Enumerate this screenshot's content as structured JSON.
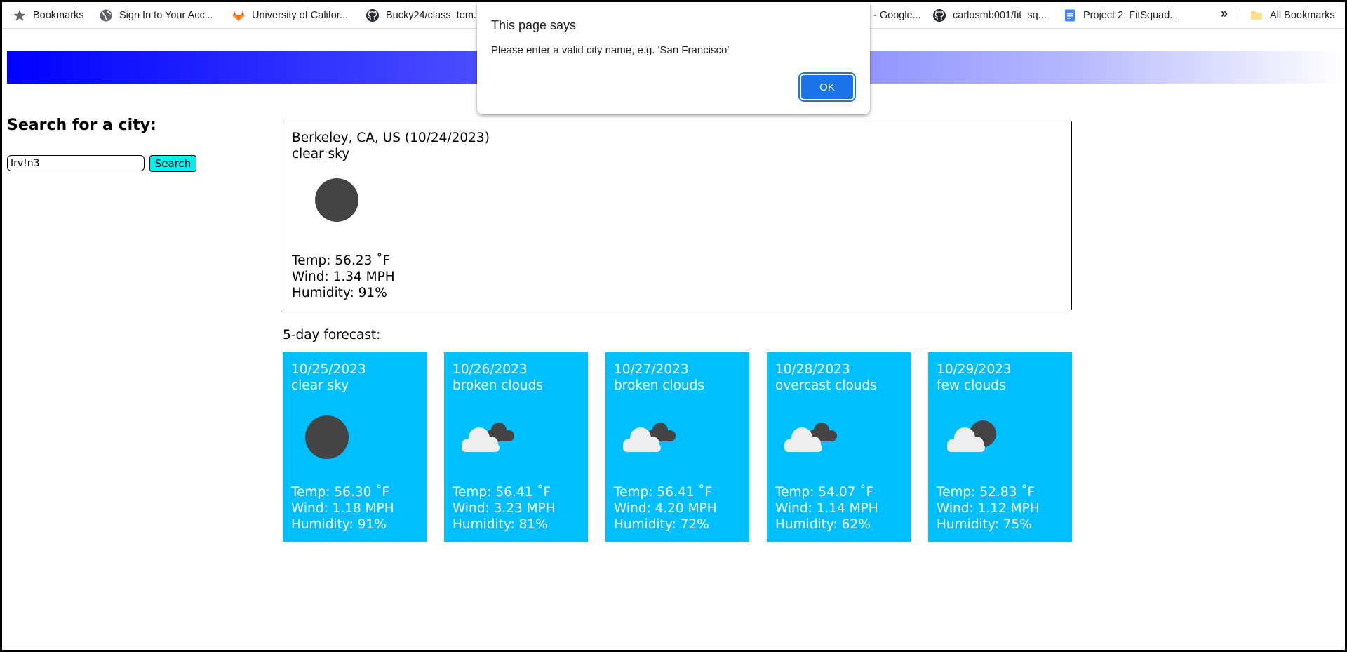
{
  "bookmarks_bar": {
    "items": [
      {
        "label": "Bookmarks",
        "icon": "star-icon"
      },
      {
        "label": "Sign In to Your Acc...",
        "icon": "globe-icon"
      },
      {
        "label": "University of Califor...",
        "icon": "gitlab-icon"
      },
      {
        "label": "Bucky24/class_tem...",
        "icon": "github-icon"
      },
      {
        "label": "- Google...",
        "icon": "none"
      },
      {
        "label": "carlosmb001/fit_sq...",
        "icon": "github-icon"
      },
      {
        "label": "Project 2: FitSquad...",
        "icon": "docs-icon"
      },
      {
        "label": "»",
        "icon": "chevron-double-right-icon"
      },
      {
        "label": "All Bookmarks",
        "icon": "folder-icon"
      }
    ]
  },
  "banner": {
    "gradient_start": "#0000ff",
    "gradient_end": "#ffffff"
  },
  "sidebar": {
    "heading": "Search for a city:",
    "input_value": "Irv!n3",
    "search_button": "Search",
    "button_color": "#00f0f0"
  },
  "current": {
    "title": "Berkeley, CA, US (10/24/2023)",
    "description": "clear sky",
    "icon": "sun-icon",
    "temp": "Temp: 56.23 ˚F",
    "wind": "Wind: 1.34 MPH",
    "humidity": "Humidity: 91%"
  },
  "forecast": {
    "heading": "5-day forecast:",
    "card_color": "#00bfff",
    "days": [
      {
        "date": "10/25/2023",
        "description": "clear sky",
        "icon": "sun-icon",
        "temp": "Temp: 56.30 ˚F",
        "wind": "Wind: 1.18 MPH",
        "humidity": "Humidity: 91%"
      },
      {
        "date": "10/26/2023",
        "description": "broken clouds",
        "icon": "broken-clouds-icon",
        "temp": "Temp: 56.41 ˚F",
        "wind": "Wind: 3.23 MPH",
        "humidity": "Humidity: 81%"
      },
      {
        "date": "10/27/2023",
        "description": "broken clouds",
        "icon": "broken-clouds-icon",
        "temp": "Temp: 56.41 ˚F",
        "wind": "Wind: 4.20 MPH",
        "humidity": "Humidity: 72%"
      },
      {
        "date": "10/28/2023",
        "description": "overcast clouds",
        "icon": "overcast-clouds-icon",
        "temp": "Temp: 54.07 ˚F",
        "wind": "Wind: 1.14 MPH",
        "humidity": "Humidity: 62%"
      },
      {
        "date": "10/29/2023",
        "description": "few clouds",
        "icon": "few-clouds-icon",
        "temp": "Temp: 52.83 ˚F",
        "wind": "Wind: 1.12 MPH",
        "humidity": "Humidity: 75%"
      }
    ]
  },
  "dialog": {
    "title": "This page says",
    "message": "Please enter a valid city name, e.g. 'San Francisco'",
    "ok_button": "OK",
    "button_color": "#1a73e8"
  }
}
